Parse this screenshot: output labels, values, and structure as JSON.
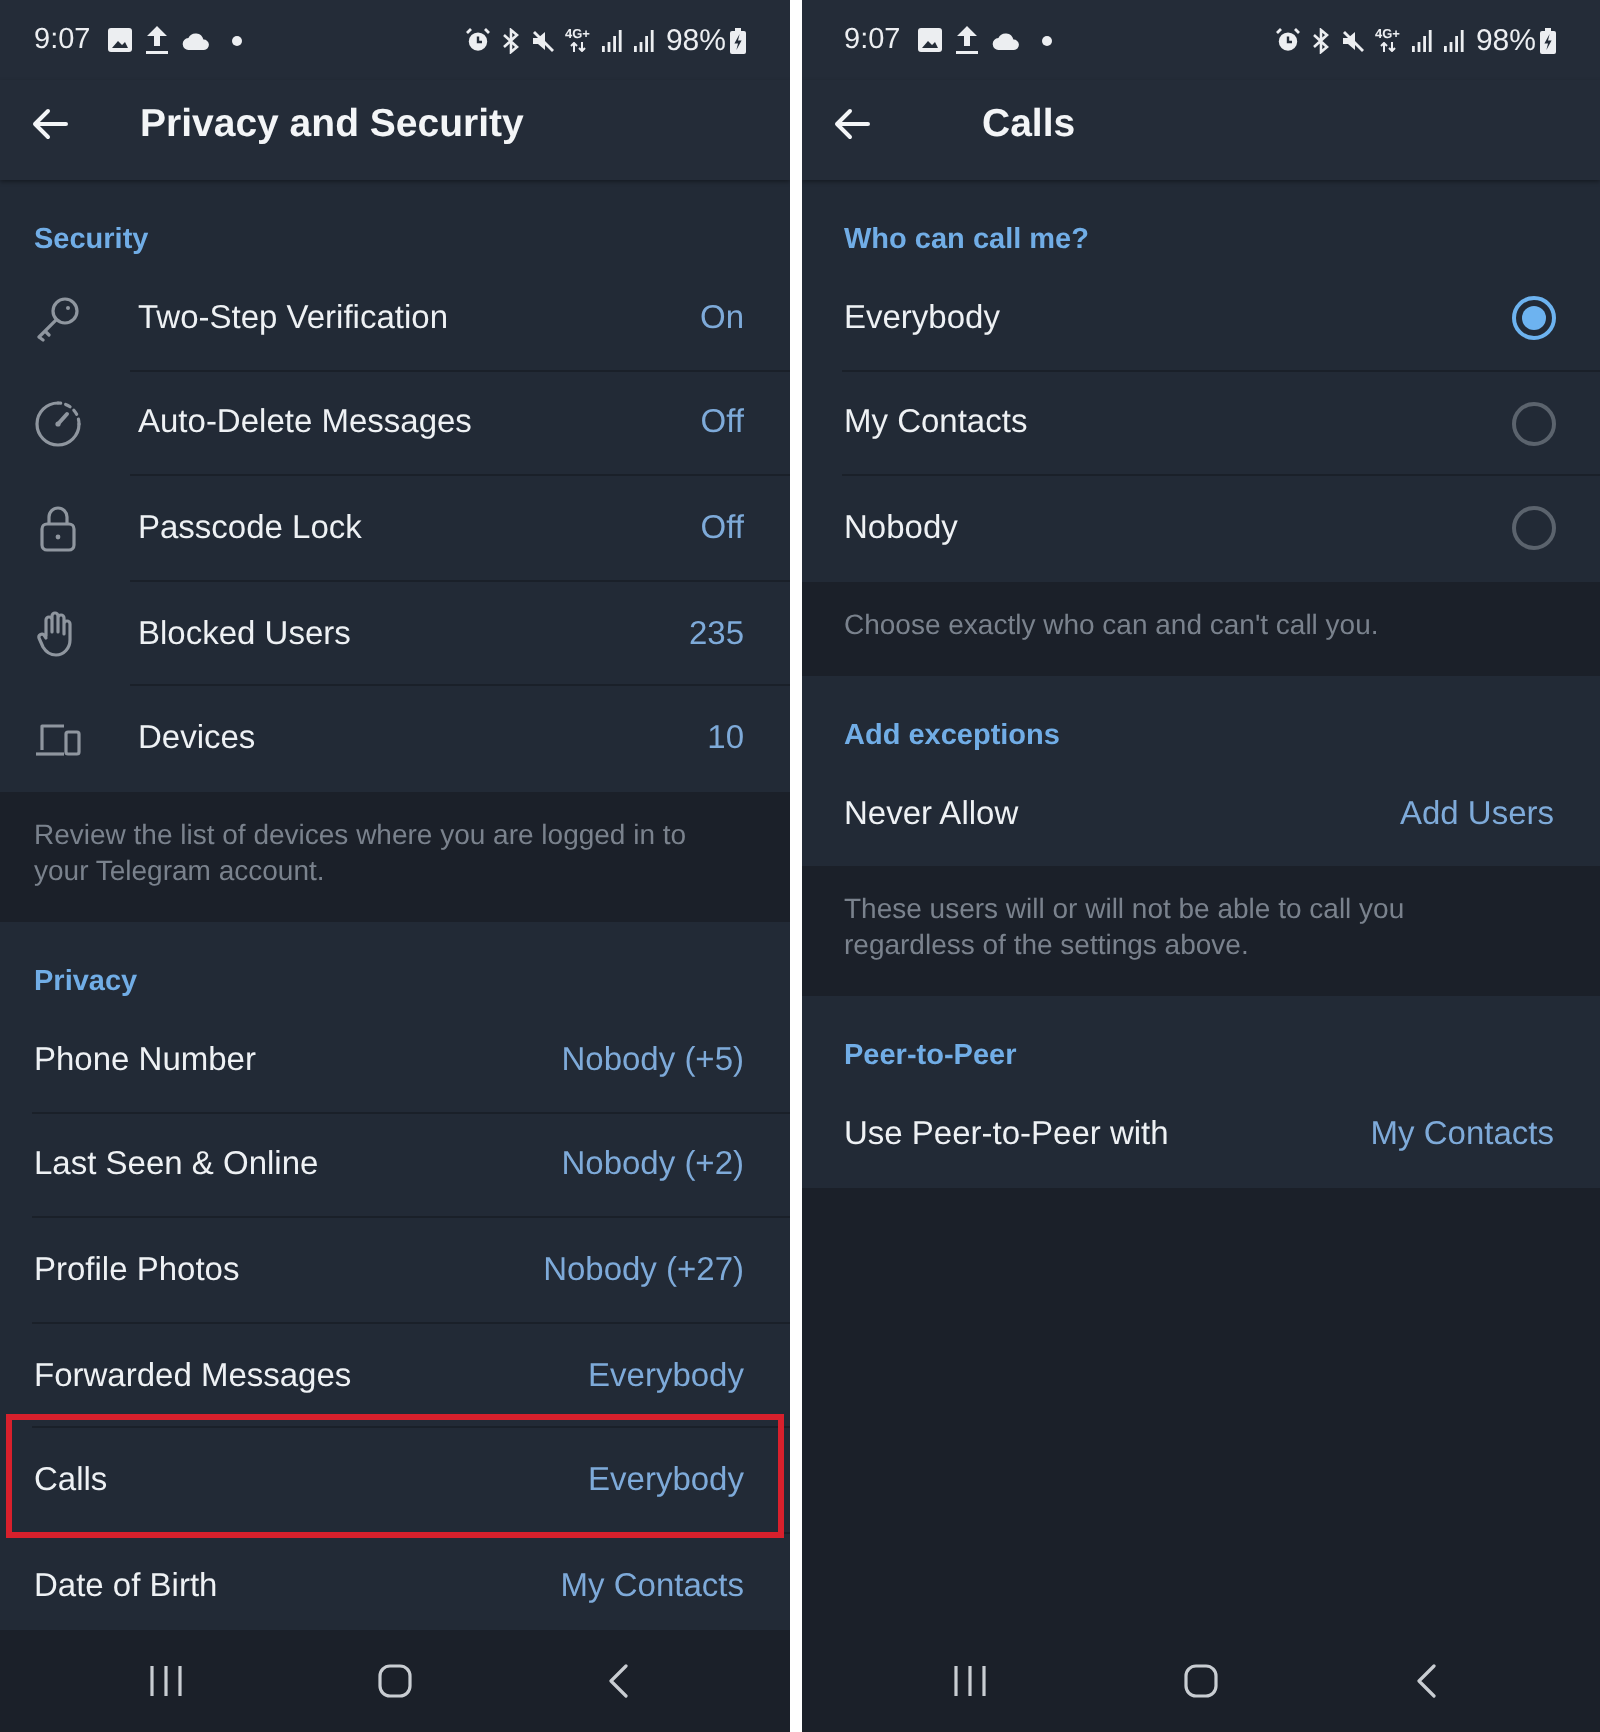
{
  "screens": [
    {
      "status_bar": {
        "time": "9:07",
        "network": "4G+",
        "battery": "98%"
      },
      "title": "Privacy and Security",
      "sections": [
        {
          "kind": "icon-list",
          "header": "Security",
          "rows": [
            {
              "label": "Two-Step Verification",
              "value": "On"
            },
            {
              "label": "Auto-Delete Messages",
              "value": "Off"
            },
            {
              "label": "Passcode Lock",
              "value": "Off"
            },
            {
              "label": "Blocked Users",
              "value": "235"
            },
            {
              "label": "Devices",
              "value": "10"
            }
          ],
          "note": "Review the list of devices where you are logged in to your Telegram account."
        },
        {
          "kind": "list",
          "header": "Privacy",
          "rows": [
            {
              "label": "Phone Number",
              "value": "Nobody (+5)",
              "highlighted": false
            },
            {
              "label": "Last Seen & Online",
              "value": "Nobody (+2)",
              "highlighted": false
            },
            {
              "label": "Profile Photos",
              "value": "Nobody (+27)",
              "highlighted": false
            },
            {
              "label": "Forwarded Messages",
              "value": "Everybody",
              "highlighted": false
            },
            {
              "label": "Calls",
              "value": "Everybody",
              "highlighted": true
            },
            {
              "label": "Date of Birth",
              "value": "My Contacts",
              "highlighted": false
            }
          ]
        }
      ]
    },
    {
      "status_bar": {
        "time": "9:07",
        "network": "4G+",
        "battery": "98%"
      },
      "title": "Calls",
      "sections": [
        {
          "kind": "radio-list",
          "header": "Who can call me?",
          "rows": [
            {
              "label": "Everybody",
              "selected": true
            },
            {
              "label": "My Contacts",
              "selected": false
            },
            {
              "label": "Nobody",
              "selected": false
            }
          ],
          "note": "Choose exactly who can and can't call you."
        },
        {
          "kind": "list",
          "header": "Add exceptions",
          "rows": [
            {
              "label": "Never Allow",
              "value": "Add Users"
            }
          ],
          "note": "These users will or will not be able to call you regardless of the settings above."
        },
        {
          "kind": "list",
          "header": "Peer-to-Peer",
          "rows": [
            {
              "label": "Use Peer-to-Peer with",
              "value": "My Contacts"
            }
          ]
        }
      ]
    }
  ]
}
